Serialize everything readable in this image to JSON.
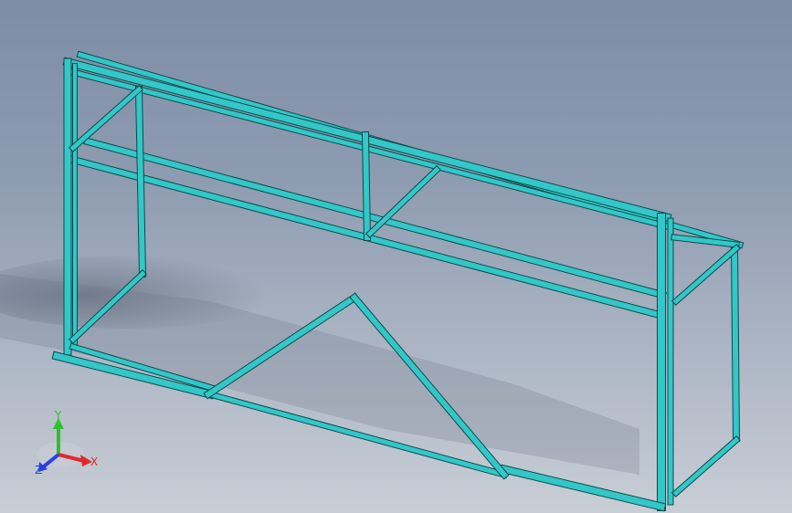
{
  "view": {
    "background_top": "#7d8da5",
    "background_bottom": "#c9ced6",
    "frame_color": "#33c7c7",
    "frame_edge_color": "#0e4a4e",
    "shadow_color": "#5f6a7a"
  },
  "triad": {
    "x_label": "X",
    "y_label": "Y",
    "z_label": "Z",
    "x_color": "#e02a2a",
    "y_color": "#2fbf2f",
    "z_color": "#2a3fe0"
  }
}
